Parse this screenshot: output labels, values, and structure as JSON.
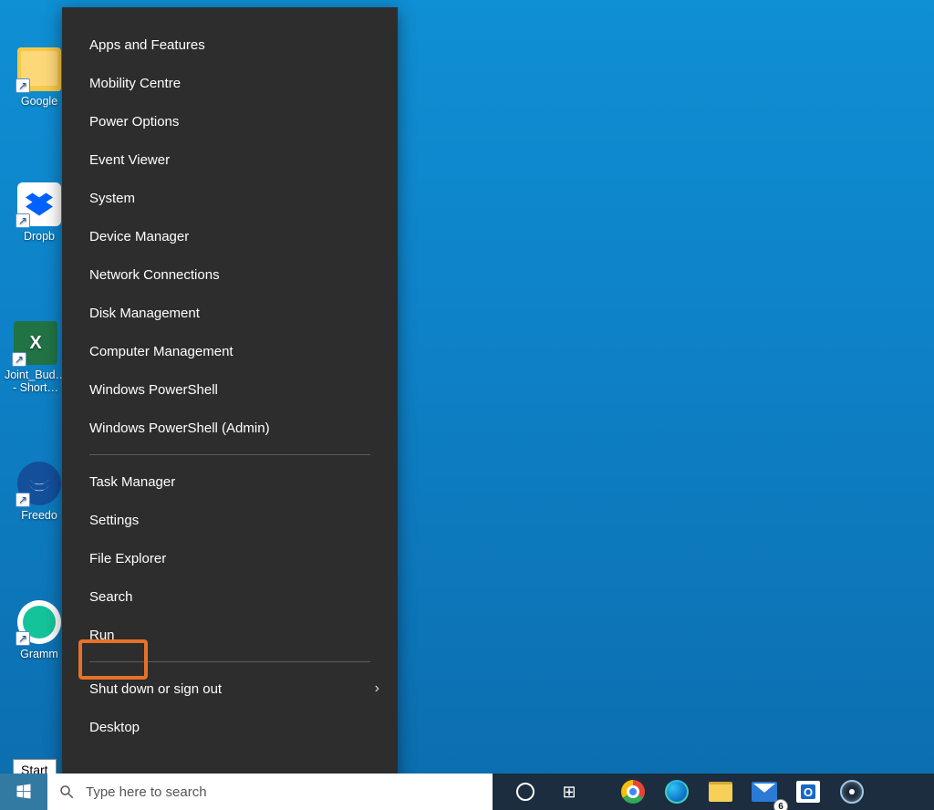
{
  "desktop": {
    "icons": [
      {
        "name": "google-drive-shortcut",
        "label": "Google"
      },
      {
        "name": "dropbox-shortcut",
        "label": "Dropb"
      },
      {
        "name": "excel-shortcut",
        "label": "Joint_Bud… - Short…"
      },
      {
        "name": "freedom-shortcut",
        "label": "Freedo"
      },
      {
        "name": "grammarly-shortcut",
        "label": "Gramm"
      }
    ]
  },
  "power_user_menu": {
    "section1": [
      "Apps and Features",
      "Mobility Centre",
      "Power Options",
      "Event Viewer",
      "System",
      "Device Manager",
      "Network Connections",
      "Disk Management",
      "Computer Management",
      "Windows PowerShell",
      "Windows PowerShell (Admin)"
    ],
    "section2": [
      "Task Manager",
      "Settings",
      "File Explorer",
      "Search",
      "Run"
    ],
    "section3": [
      {
        "label": "Shut down or sign out",
        "submenu": true
      },
      {
        "label": "Desktop",
        "submenu": false
      }
    ]
  },
  "taskbar": {
    "start_tooltip": "Start",
    "search_placeholder": "Type here to search",
    "mail_badge": "6"
  }
}
